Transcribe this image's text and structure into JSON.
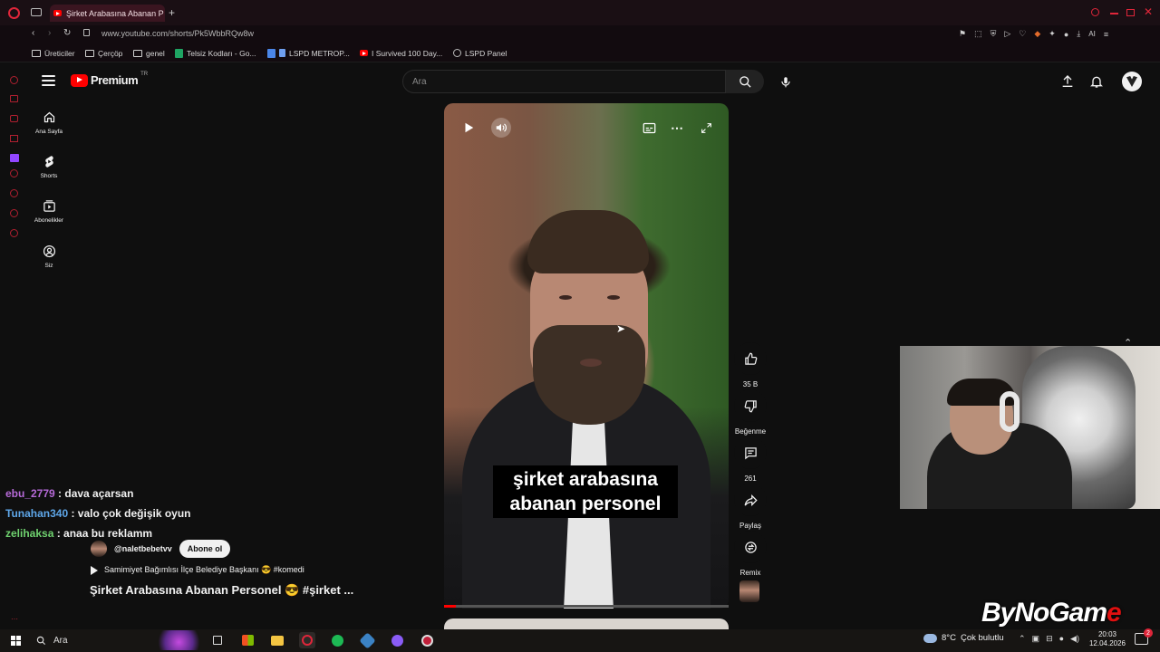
{
  "browser": {
    "tab_title": "Şirket Arabasına Abanan P",
    "new_tab": "+",
    "url": "www.youtube.com/shorts/Pk5WbbRQw8w",
    "ai_label": "AI",
    "bookmarks": [
      {
        "label": "Üreticiler",
        "icon": "folder-icon"
      },
      {
        "label": "Çerçöp",
        "icon": "folder-icon"
      },
      {
        "label": "genel",
        "icon": "folder-icon"
      },
      {
        "label": "Telsiz Kodları - Go...",
        "icon": "sheets-icon"
      },
      {
        "label": "LSPD METROP...",
        "icon": "docs-icon"
      },
      {
        "label": "I Survived 100 Day...",
        "icon": "youtube-icon"
      },
      {
        "label": "LSPD Panel",
        "icon": "globe-icon"
      }
    ]
  },
  "youtube": {
    "logo_text": "Premium",
    "logo_region": "TR",
    "search_placeholder": "Ara",
    "sidebar": [
      {
        "label": "Ana Sayfa",
        "icon": "home-icon"
      },
      {
        "label": "Shorts",
        "icon": "shorts-icon"
      },
      {
        "label": "Abonelikler",
        "icon": "subscriptions-icon"
      },
      {
        "label": "Siz",
        "icon": "account-icon"
      }
    ],
    "caption_line1": "şirket arabasına",
    "caption_line2": "abanan personel",
    "progress": 0.04,
    "actions": {
      "like_count": "35 B",
      "dislike_label": "Beğenme",
      "comment_count": "261",
      "share_label": "Paylaş",
      "remix_label": "Remix"
    },
    "channel_handle": "@naletbebetvv",
    "subscribe_label": "Abone ol",
    "description": "Samimiyet Bağımlısı İlçe Belediye Başkanı 😎 #komedi",
    "video_title": "Şirket Arabasına Abanan Personel 😎 #şirket ..."
  },
  "chat": [
    {
      "user": "ebu_2779",
      "message": " : dava açarsan",
      "color": "#b66ad8"
    },
    {
      "user": "Tunahan340",
      "message": " : valo çok değişik oyun",
      "color": "#5ea6e8"
    },
    {
      "user": "zelihaksa",
      "message": " : anaa bu reklamm",
      "color": "#6fd26f"
    }
  ],
  "taskbar": {
    "search_placeholder": "Ara",
    "weather": "8°C",
    "weather_text": "Çok bulutlu",
    "time": "20:03",
    "date": "12.04.2026",
    "notification_count": "2"
  },
  "watermark": {
    "part1": "ByNoGam",
    "part2": "e"
  },
  "colors": {
    "accent": "#ff0000",
    "opera": "#e0263a"
  }
}
